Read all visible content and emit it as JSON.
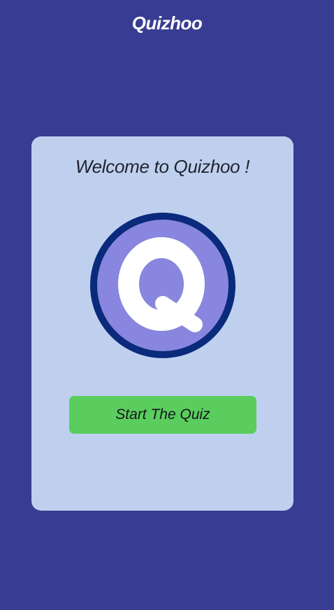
{
  "header": {
    "title": "Quizhoo"
  },
  "card": {
    "welcome_text": "Welcome to Quizhoo !",
    "logo": {
      "icon": "q-logo-icon",
      "letter": "Q",
      "colors": {
        "ring": "#0a2a7c",
        "fill": "#8886de",
        "letter": "#ffffff"
      }
    },
    "start_button_label": "Start The Quiz"
  },
  "colors": {
    "background": "#383c92",
    "card": "#bfd0ee",
    "button": "#5acd5e"
  }
}
